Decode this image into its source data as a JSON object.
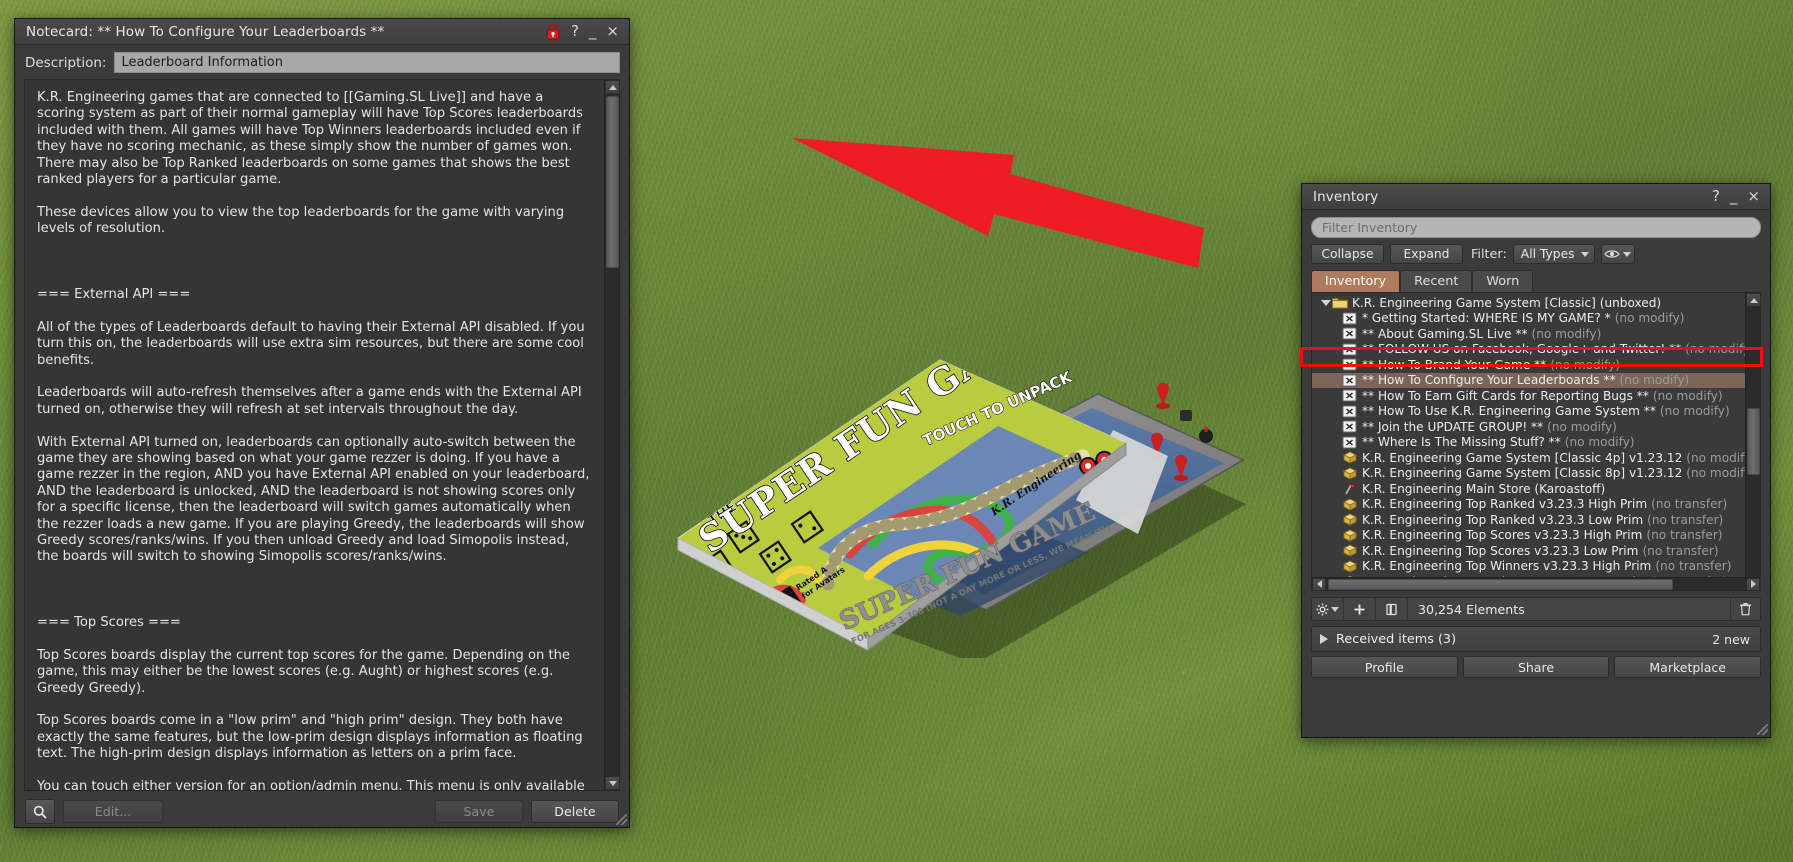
{
  "scene": {
    "annotation_arrow_color": "#ee1c25",
    "annotation_box_color": "#f20d0d",
    "object": {
      "brand": "K.R. Engineering",
      "title_the": "THE",
      "title_main": "SUPER FUN GAME",
      "hover_text": "TOUCH TO UNPACK",
      "rating_letter": "A",
      "rating_line1": "Rated A",
      "rating_line2": "for Avatars",
      "box_side_title": "SUPER FUN GAME",
      "box_side_sub": "FOR AGES 3-300 (NOT A DAY MORE OR LESS, WE MEAN IT!)"
    }
  },
  "notecard": {
    "title": "Notecard: ** How To Configure Your Leaderboards **",
    "titlebar_icons": [
      "lock-icon",
      "help-icon",
      "minimize-icon",
      "close-icon"
    ],
    "help_glyph": "?",
    "minimize_glyph": "_",
    "close_glyph": "×",
    "description_label": "Description:",
    "description_value": "Leaderboard Information",
    "body": "K.R. Engineering games that are connected to [[Gaming.SL Live]] and have a scoring system as part of their normal gameplay will have Top Scores leaderboards included with them. All games will have Top Winners leaderboards included even if they have no scoring mechanic, as these simply show the number of games won. There may also be Top Ranked leaderboards on some games that shows the best ranked players for a particular game.\n\nThese devices allow you to view the top leaderboards for the game with varying levels of resolution.\n\n\n\n=== External API ===\n\nAll of the types of Leaderboards default to having their External API disabled. If you turn this on, the leaderboards will use extra sim resources, but there are some cool benefits.\n\nLeaderboards will auto-refresh themselves after a game ends with the External API turned on, otherwise they will refresh at set intervals throughout the day.\n\nWith External API turned on, leaderboards can optionally auto-switch between the game they are showing based on what your game rezzer is doing. If you have a game rezzer in the region, AND you have External API enabled on your leaderboard, AND the leaderboard is unlocked, AND the leaderboard is not showing scores only for a specific license, then the leaderboard will switch games automatically when the rezzer loads a new game. If you are playing Greedy, the leaderboards will show Greedy scores/ranks/wins. If you then unload Greedy and load Simopolis instead, the boards will switch to showing Simopolis scores/ranks/wins.\n\n\n\n=== Top Scores ===\n\nTop Scores boards display the current top scores for the game. Depending on the game, this may either be the lowest scores (e.g. Aught) or highest scores (e.g. Greedy Greedy).\n\nTop Scores boards come in a \"low prim\" and \"high prim\" design. They both have exactly the same features, but the low-prim design displays information as floating text. The high-prim design displays information as letters on a prim face.\n\nYou can touch either version for an option/admin menu. This menu is only available to the owner of the Top Scores board.\n\n==== Top Scores Option Menu ====\n\n* Cancel: This button does nothing except close the menu.",
    "footer": {
      "search_icon": "search-icon",
      "edit_label": "Edit...",
      "edit_disabled": true,
      "save_label": "Save",
      "save_disabled": true,
      "delete_label": "Delete",
      "delete_disabled": false
    }
  },
  "inventory": {
    "title": "Inventory",
    "help_glyph": "?",
    "minimize_glyph": "_",
    "close_glyph": "×",
    "filter_placeholder": "Filter Inventory",
    "filter_value": "",
    "collapse_label": "Collapse",
    "expand_label": "Expand",
    "filter_label": "Filter:",
    "type_filter_value": "All Types",
    "tabs": [
      {
        "label": "Inventory",
        "active": true
      },
      {
        "label": "Recent",
        "active": false
      },
      {
        "label": "Worn",
        "active": false
      }
    ],
    "items": [
      {
        "label": "K.R. Engineering Game System [Classic] (unboxed)",
        "perm": "",
        "icon": "folder-icon",
        "level": 0,
        "expanded": true,
        "selected": false
      },
      {
        "label": "* Getting Started: WHERE IS MY GAME? *",
        "perm": "(no modify)",
        "icon": "notecard-icon",
        "level": 1,
        "selected": false
      },
      {
        "label": "** About Gaming.SL Live **",
        "perm": "(no modify)",
        "icon": "notecard-icon",
        "level": 1,
        "selected": false
      },
      {
        "label": "** FOLLOW US on Facebook, Google+ and Twitter! **",
        "perm": "(no modify)",
        "icon": "notecard-icon",
        "level": 1,
        "selected": false
      },
      {
        "label": "** How To Brand Your Game **",
        "perm": "(no modify)",
        "icon": "notecard-icon",
        "level": 1,
        "selected": false
      },
      {
        "label": "** How To Configure Your Leaderboards **",
        "perm": "(no modify)",
        "icon": "notecard-icon",
        "level": 1,
        "selected": true
      },
      {
        "label": "** How To Earn Gift Cards for Reporting Bugs **",
        "perm": "(no modify)",
        "icon": "notecard-icon",
        "level": 1,
        "selected": false
      },
      {
        "label": "** How To Use K.R. Engineering Game System **",
        "perm": "(no modify)",
        "icon": "notecard-icon",
        "level": 1,
        "selected": false
      },
      {
        "label": "** Join the UPDATE GROUP! **",
        "perm": "(no modify)",
        "icon": "notecard-icon",
        "level": 1,
        "selected": false
      },
      {
        "label": "** Where Is The Missing Stuff? **",
        "perm": "(no modify)",
        "icon": "notecard-icon",
        "level": 1,
        "selected": false
      },
      {
        "label": "K.R. Engineering Game System [Classic 4p] v1.23.12",
        "perm": "(no modify) (no transfe",
        "icon": "object-icon",
        "level": 1,
        "selected": false
      },
      {
        "label": "K.R. Engineering Game System [Classic 8p] v1.23.12",
        "perm": "(no modify) (no transfe",
        "icon": "object-icon",
        "level": 1,
        "selected": false
      },
      {
        "label": "K.R. Engineering Main Store (Karoastoff)",
        "perm": "",
        "icon": "landmark-icon",
        "level": 1,
        "selected": false
      },
      {
        "label": "K.R. Engineering Top Ranked v3.23.3 High Prim",
        "perm": "(no transfer)",
        "icon": "object-icon",
        "level": 1,
        "selected": false
      },
      {
        "label": "K.R. Engineering Top Ranked v3.23.3 Low Prim",
        "perm": "(no transfer)",
        "icon": "object-icon",
        "level": 1,
        "selected": false
      },
      {
        "label": "K.R. Engineering Top Scores v3.23.3 High Prim",
        "perm": "(no transfer)",
        "icon": "object-icon",
        "level": 1,
        "selected": false
      },
      {
        "label": "K.R. Engineering Top Scores v3.23.3 Low Prim",
        "perm": "(no transfer)",
        "icon": "object-icon",
        "level": 1,
        "selected": false
      },
      {
        "label": "K.R. Engineering Top Winners v3.23.3 High Prim",
        "perm": "(no transfer)",
        "icon": "object-icon",
        "level": 1,
        "selected": false
      },
      {
        "label": "K.R. Engineering Top Winners v3.23.3 Low Prim",
        "perm": "(no transfer)",
        "icon": "object-icon",
        "level": 1,
        "selected": false
      }
    ],
    "status": {
      "gear_icon": "gear-icon",
      "add_icon": "plus-icon",
      "wear_icon": "outfit-icon",
      "element_count": "30,254 Elements",
      "trash_icon": "trash-icon"
    },
    "received": {
      "label": "Received items (3)",
      "new_count": "2 new"
    },
    "footer_buttons": [
      "Profile",
      "Share",
      "Marketplace"
    ]
  }
}
